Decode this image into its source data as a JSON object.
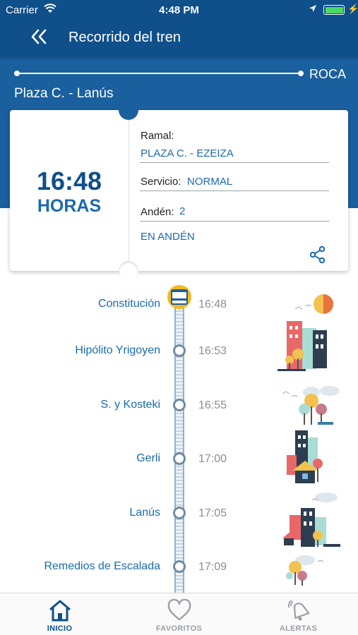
{
  "status_bar": {
    "carrier": "Carrier",
    "time": "4:48 PM"
  },
  "header": {
    "title": "Recorrido del tren",
    "back_icon": "double-chevron-left-icon"
  },
  "route": {
    "line_name": "ROCA",
    "stations": "Plaza C. - Lanús"
  },
  "card": {
    "time": "16:48",
    "time_unit": "HORAS",
    "ramal_label": "Ramal:",
    "ramal_value": "PLAZA C. - EZEIZA",
    "servicio_label": "Servicio:",
    "servicio_value": "NORMAL",
    "anden_label": "Andén:",
    "anden_value": "2",
    "status": "EN ANDÉN",
    "share_icon": "share-icon"
  },
  "stops": [
    {
      "name": "Constitución",
      "time": "16:48"
    },
    {
      "name": "Hipólito Yrigoyen",
      "time": "16:53"
    },
    {
      "name": "S. y Kosteki",
      "time": "16:55"
    },
    {
      "name": "Gerli",
      "time": "17:00"
    },
    {
      "name": "Lanús",
      "time": "17:05"
    },
    {
      "name": "Remedios de Escalada",
      "time": "17:09"
    }
  ],
  "tabs": [
    {
      "label": "INICIO",
      "icon": "home-icon",
      "active": true
    },
    {
      "label": "FAVORITOS",
      "icon": "heart-icon",
      "active": false
    },
    {
      "label": "ALERTAS",
      "icon": "alert-bell-icon",
      "active": false
    }
  ],
  "colors": {
    "primary": "#0f4f8a",
    "hero": "#1a5f9e",
    "accent": "#1a6aaf",
    "muted": "#8a8f94"
  }
}
